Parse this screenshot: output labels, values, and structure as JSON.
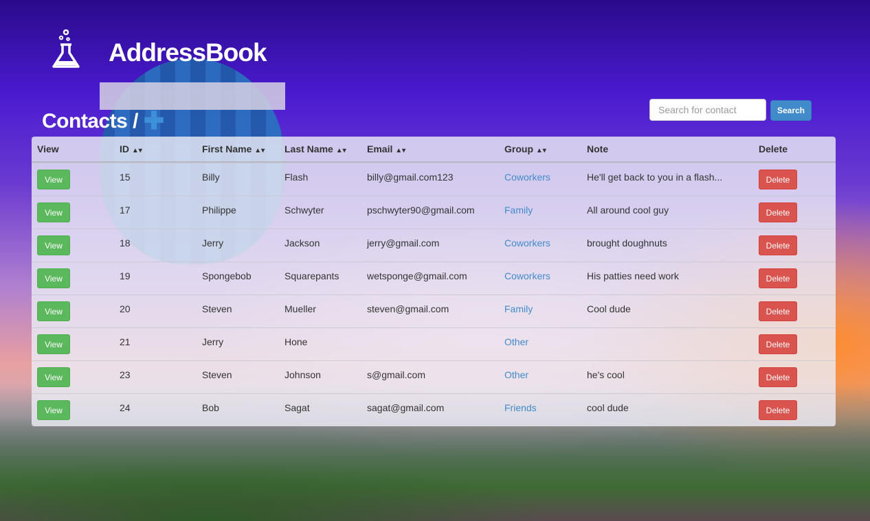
{
  "app": {
    "name": "AddressBook",
    "logo_icon": "flask-icon"
  },
  "page": {
    "title": "Contacts /",
    "add_icon": "plus-icon"
  },
  "search": {
    "placeholder": "Search for contact",
    "value": "",
    "button": "Search"
  },
  "colors": {
    "view": "#5cb85c",
    "delete": "#d9534f",
    "link": "#428bca",
    "search": "#428bca"
  },
  "table": {
    "columns": [
      {
        "label": "View",
        "sort": ""
      },
      {
        "label": "ID",
        "sort": "▲▾"
      },
      {
        "label": "First Name",
        "sort": "▲▾"
      },
      {
        "label": "Last Name",
        "sort": "▲▾"
      },
      {
        "label": "Email",
        "sort": "▲▾"
      },
      {
        "label": "Group",
        "sort": "▲▾"
      },
      {
        "label": "Note",
        "sort": ""
      },
      {
        "label": "Delete",
        "sort": ""
      }
    ],
    "view_label": "View",
    "delete_label": "Delete",
    "rows": [
      {
        "id": "15",
        "first": "Billy",
        "last": "Flash",
        "email": "billy@gmail.com123",
        "group": "Coworkers",
        "note": "He'll get back to you in a flash..."
      },
      {
        "id": "17",
        "first": "Philippe",
        "last": "Schwyter",
        "email": "pschwyter90@gmail.com",
        "group": "Family",
        "note": "All around cool guy"
      },
      {
        "id": "18",
        "first": "Jerry",
        "last": "Jackson",
        "email": "jerry@gmail.com",
        "group": "Coworkers",
        "note": "brought doughnuts"
      },
      {
        "id": "19",
        "first": "Spongebob",
        "last": "Squarepants",
        "email": "wetsponge@gmail.com",
        "group": "Coworkers",
        "note": "His patties need work"
      },
      {
        "id": "20",
        "first": "Steven",
        "last": "Mueller",
        "email": "steven@gmail.com",
        "group": "Family",
        "note": "Cool dude"
      },
      {
        "id": "21",
        "first": "Jerry",
        "last": "Hone",
        "email": "",
        "group": "Other",
        "note": ""
      },
      {
        "id": "23",
        "first": "Steven",
        "last": "Johnson",
        "email": "s@gmail.com",
        "group": "Other",
        "note": "he's cool"
      },
      {
        "id": "24",
        "first": "Bob",
        "last": "Sagat",
        "email": "sagat@gmail.com",
        "group": "Friends",
        "note": "cool dude"
      }
    ]
  }
}
